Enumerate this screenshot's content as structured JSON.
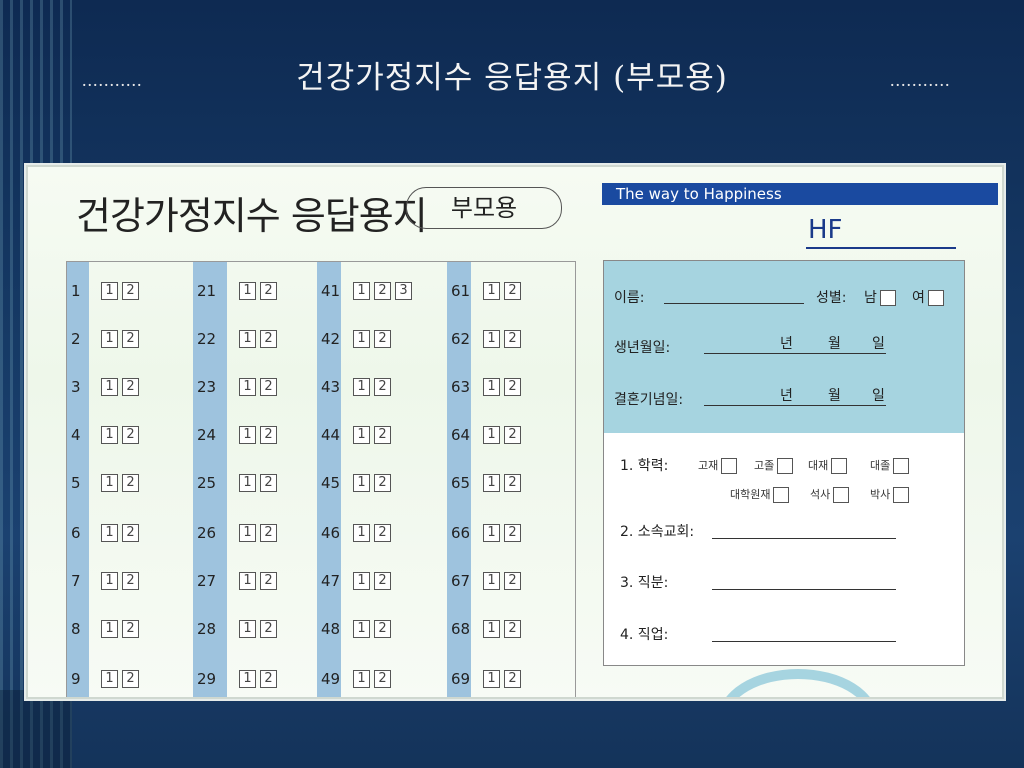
{
  "slide": {
    "title": "건강가정지수 응답용지 (부모용)",
    "dots_left": "...........",
    "dots_right": "..........."
  },
  "form": {
    "title": "건강가정지수 응답용지",
    "pill": "부모용",
    "tagline": "The way to Happiness",
    "logo": "HF"
  },
  "grid": {
    "columns": [
      {
        "rows": [
          {
            "n": "1",
            "opts": [
              "1",
              "2"
            ]
          },
          {
            "n": "2",
            "opts": [
              "1",
              "2"
            ]
          },
          {
            "n": "3",
            "opts": [
              "1",
              "2"
            ]
          },
          {
            "n": "4",
            "opts": [
              "1",
              "2"
            ]
          },
          {
            "n": "5",
            "opts": [
              "1",
              "2"
            ]
          },
          {
            "n": "6",
            "opts": [
              "1",
              "2"
            ]
          },
          {
            "n": "7",
            "opts": [
              "1",
              "2"
            ]
          },
          {
            "n": "8",
            "opts": [
              "1",
              "2"
            ]
          },
          {
            "n": "9",
            "opts": [
              "1",
              "2"
            ]
          }
        ]
      },
      {
        "rows": [
          {
            "n": "21",
            "opts": [
              "1",
              "2"
            ]
          },
          {
            "n": "22",
            "opts": [
              "1",
              "2"
            ]
          },
          {
            "n": "23",
            "opts": [
              "1",
              "2"
            ]
          },
          {
            "n": "24",
            "opts": [
              "1",
              "2"
            ]
          },
          {
            "n": "25",
            "opts": [
              "1",
              "2"
            ]
          },
          {
            "n": "26",
            "opts": [
              "1",
              "2"
            ]
          },
          {
            "n": "27",
            "opts": [
              "1",
              "2"
            ]
          },
          {
            "n": "28",
            "opts": [
              "1",
              "2"
            ]
          },
          {
            "n": "29",
            "opts": [
              "1",
              "2"
            ]
          }
        ]
      },
      {
        "rows": [
          {
            "n": "41",
            "opts": [
              "1",
              "2",
              "3"
            ]
          },
          {
            "n": "42",
            "opts": [
              "1",
              "2"
            ]
          },
          {
            "n": "43",
            "opts": [
              "1",
              "2"
            ]
          },
          {
            "n": "44",
            "opts": [
              "1",
              "2"
            ]
          },
          {
            "n": "45",
            "opts": [
              "1",
              "2"
            ]
          },
          {
            "n": "46",
            "opts": [
              "1",
              "2"
            ]
          },
          {
            "n": "47",
            "opts": [
              "1",
              "2"
            ]
          },
          {
            "n": "48",
            "opts": [
              "1",
              "2"
            ]
          },
          {
            "n": "49",
            "opts": [
              "1",
              "2"
            ]
          }
        ]
      },
      {
        "rows": [
          {
            "n": "61",
            "opts": [
              "1",
              "2"
            ]
          },
          {
            "n": "62",
            "opts": [
              "1",
              "2"
            ]
          },
          {
            "n": "63",
            "opts": [
              "1",
              "2"
            ]
          },
          {
            "n": "64",
            "opts": [
              "1",
              "2"
            ]
          },
          {
            "n": "65",
            "opts": [
              "1",
              "2"
            ]
          },
          {
            "n": "66",
            "opts": [
              "1",
              "2"
            ]
          },
          {
            "n": "67",
            "opts": [
              "1",
              "2"
            ]
          },
          {
            "n": "68",
            "opts": [
              "1",
              "2"
            ]
          },
          {
            "n": "69",
            "opts": [
              "1",
              "2"
            ]
          }
        ]
      }
    ]
  },
  "info": {
    "name_label": "이름:",
    "gender_label": "성별:",
    "male": "남",
    "female": "여",
    "birth_label": "생년월일:",
    "wedding_label": "결혼기념일:",
    "year": "년",
    "month": "월",
    "day": "일",
    "education_label": "1. 학력:",
    "education_options": [
      "고재",
      "고졸",
      "대재",
      "대졸",
      "대학원재",
      "석사",
      "박사"
    ],
    "church_label": "2. 소속교회:",
    "position_label": "3. 직분:",
    "job_label": "4. 직업:"
  }
}
